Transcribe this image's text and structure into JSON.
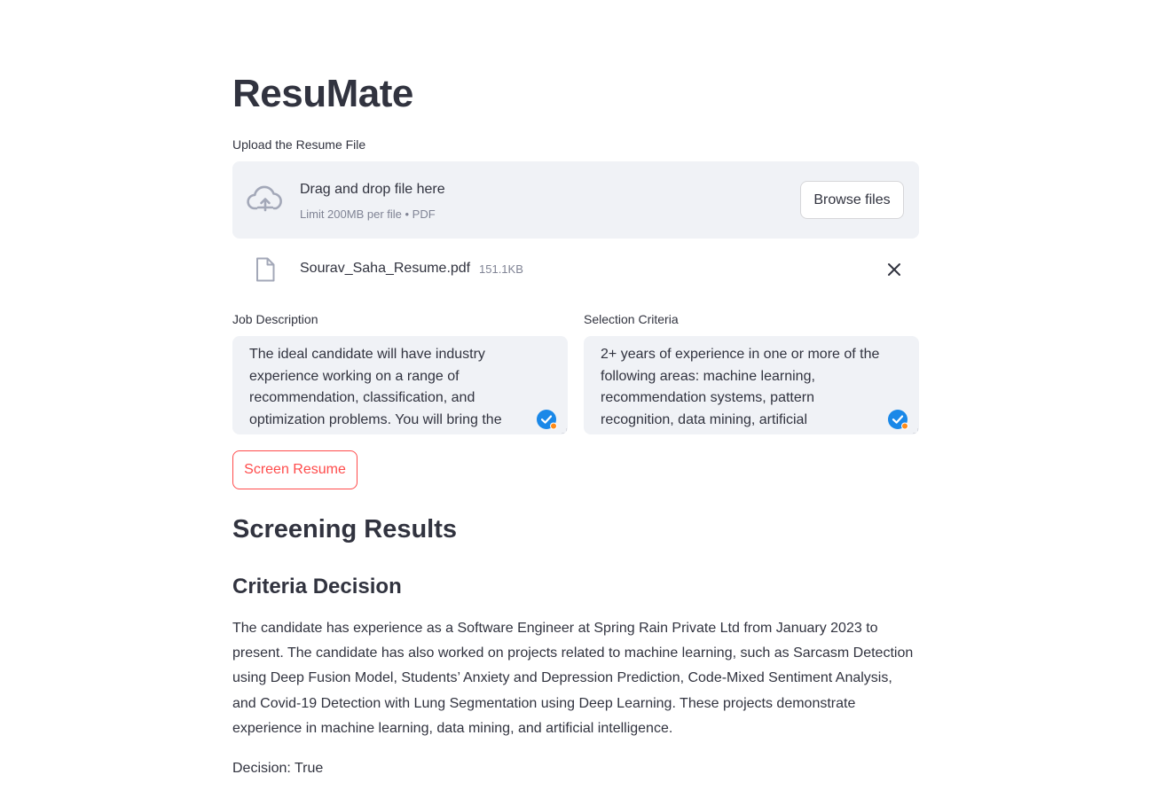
{
  "app": {
    "title": "ResuMate"
  },
  "uploader": {
    "label": "Upload the Resume File",
    "drop_title": "Drag and drop file here",
    "drop_subtitle": "Limit 200MB per file • PDF",
    "browse_label": "Browse files",
    "file": {
      "name": "Sourav_Saha_Resume.pdf",
      "size": "151.1KB"
    }
  },
  "job_description": {
    "label": "Job Description",
    "value": "The ideal candidate will have industry experience working on a range of recommendation, classification, and optimization problems. You will bring the"
  },
  "selection_criteria": {
    "label": "Selection Criteria",
    "value": "2+ years of experience in one or more of the following areas: machine learning, recommendation systems, pattern recognition, data mining, artificial"
  },
  "actions": {
    "screen_label": "Screen Resume"
  },
  "results": {
    "heading": "Screening Results",
    "subheading": "Criteria Decision",
    "summary": "The candidate has experience as a Software Engineer at Spring Rain Private Ltd from January 2023 to present. The candidate has also worked on projects related to machine learning, such as Sarcasm Detection using Deep Fusion Model, Students’ Anxiety and Depression Prediction, Code-Mixed Sentiment Analysis, and Covid-19 Detection with Lung Segmentation using Deep Learning. These projects demonstrate experience in machine learning, data mining, and artificial intelligence.",
    "decision": "Decision: True"
  },
  "icons": {
    "upload": "cloud-upload-icon",
    "file": "file-icon",
    "close": "close-icon",
    "grammar_badge": "grammar-check-icon"
  },
  "colors": {
    "primary": "#ff4b4b",
    "text": "#31333f",
    "muted": "#808495",
    "input_bg": "#f0f2f6",
    "badge_blue": "#1a88e8",
    "badge_orange": "#ff8c1a"
  }
}
